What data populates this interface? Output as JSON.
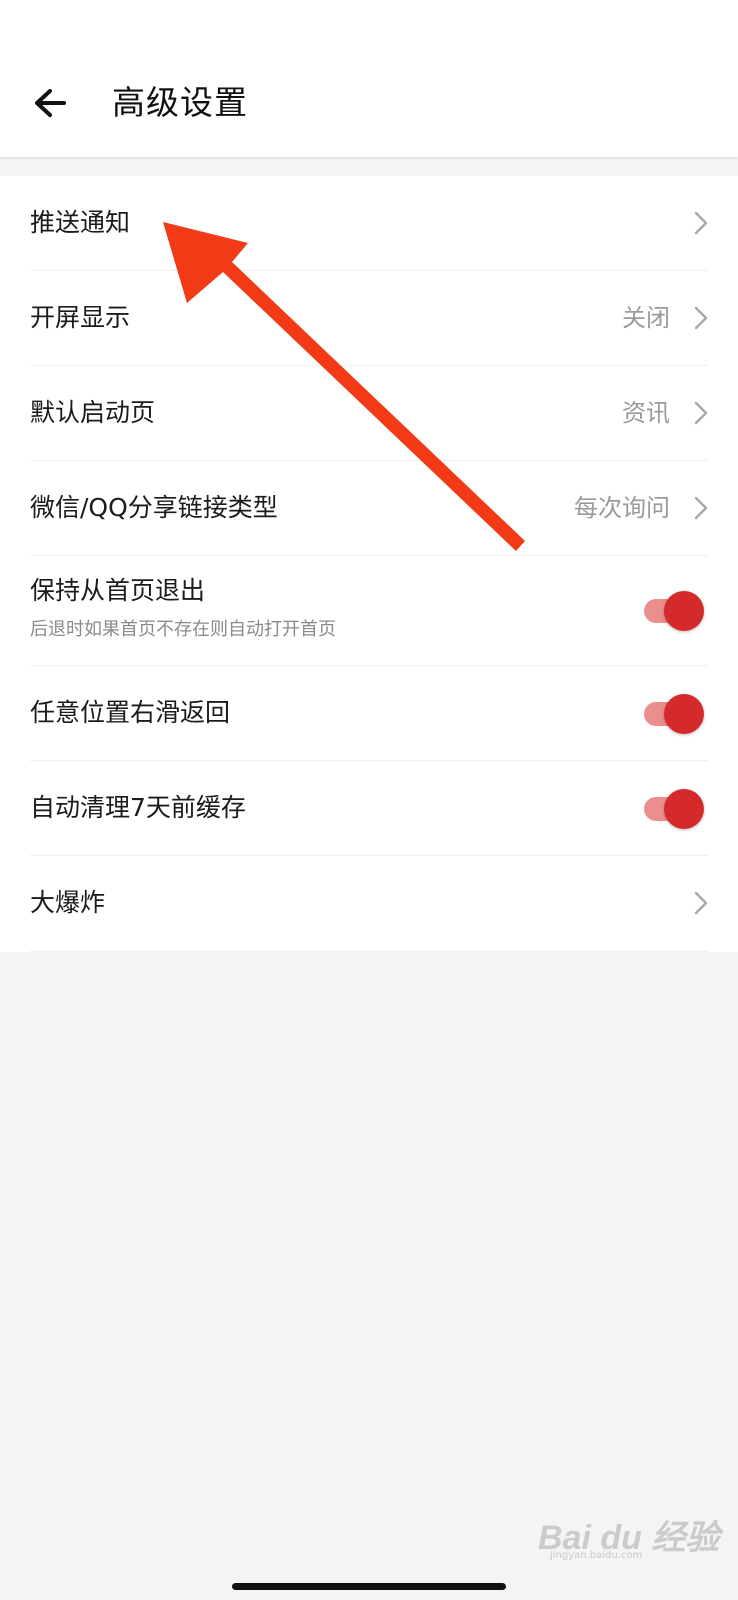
{
  "header": {
    "title": "高级设置",
    "back_icon": "arrow-left-icon"
  },
  "settings": {
    "push": {
      "label": "推送通知"
    },
    "splash": {
      "label": "开屏显示",
      "value": "关闭"
    },
    "start_page": {
      "label": "默认启动页",
      "value": "资讯"
    },
    "share_link": {
      "label": "微信/QQ分享链接类型",
      "value": "每次询问"
    },
    "keep_home": {
      "label": "保持从首页退出",
      "description": "后退时如果首页不存在则自动打开首页",
      "enabled": true
    },
    "swipe_back": {
      "label": "任意位置右滑返回",
      "enabled": true
    },
    "auto_clean": {
      "label": "自动清理7天前缓存",
      "enabled": true
    },
    "big_bang": {
      "label": "大爆炸"
    }
  },
  "colors": {
    "toggle_on_knob": "#d42a2a",
    "toggle_on_track": "#ec8e8e",
    "annotation_arrow": "#f23a16"
  },
  "watermark": {
    "brand": "Bai du 经验",
    "url": "jingyan.baidu.com"
  }
}
